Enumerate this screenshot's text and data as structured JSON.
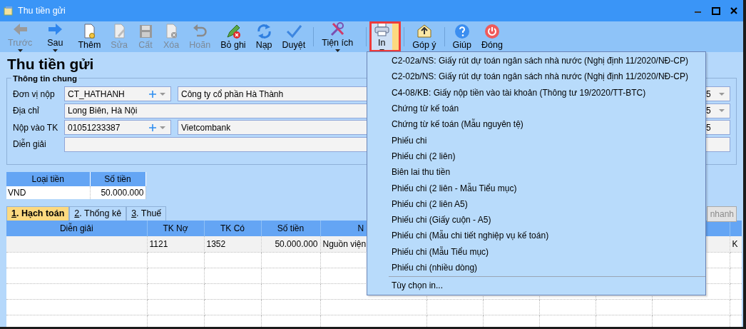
{
  "window": {
    "title": "Thu tiền gửi"
  },
  "toolbar": [
    {
      "label": "Trước",
      "disabled": true,
      "dropdown": true
    },
    {
      "label": "Sau",
      "disabled": false,
      "dropdown": true
    },
    {
      "label": "Thêm",
      "disabled": false
    },
    {
      "label": "Sửa",
      "disabled": true
    },
    {
      "label": "Cất",
      "disabled": true
    },
    {
      "label": "Xóa",
      "disabled": true
    },
    {
      "label": "Hoãn",
      "disabled": true
    },
    {
      "label": "Bỏ ghi",
      "disabled": false
    },
    {
      "label": "Nạp",
      "disabled": false
    },
    {
      "label": "Duyệt",
      "disabled": false
    },
    {
      "label": "Tiện ích",
      "disabled": false,
      "dropdown": true,
      "separator_before": true
    },
    {
      "label": "In",
      "disabled": false,
      "dropdown": true,
      "open": true,
      "separator_before": true
    },
    {
      "label": "Góp ý",
      "disabled": false,
      "separator_before": true
    },
    {
      "label": "Giúp",
      "disabled": false,
      "separator_before": true
    },
    {
      "label": "Đóng",
      "disabled": false
    }
  ],
  "page_title": "Thu tiền gửi",
  "general": {
    "legend": "Thông tin chung",
    "fields": [
      {
        "label": "Đơn vị nộp",
        "kind": "lookup",
        "code": "CT_HATHANH",
        "value": "Công ty cổ phần Hà Thành",
        "side_value": "5",
        "side_dropdown": true
      },
      {
        "label": "Địa chỉ",
        "kind": "text",
        "value": "Long Biên, Hà Nội",
        "side_value": "5",
        "side_dropdown": true
      },
      {
        "label": "Nộp vào TK",
        "kind": "lookup",
        "code": "01051233387",
        "value": "Vietcombank",
        "side_value": "5",
        "side_dropdown": false
      },
      {
        "label": "Diễn giải",
        "kind": "text",
        "side_dropdown": false
      }
    ]
  },
  "currency_table": {
    "columns": [
      "Loại tiền",
      "Số tiền"
    ],
    "rows": [
      [
        "VND",
        "50.000.000"
      ]
    ]
  },
  "tabs": [
    {
      "label": "1. Hạch toán",
      "selected": true
    },
    {
      "label": "2. Thống kê",
      "selected": false
    },
    {
      "label": "3. Thuế",
      "selected": false
    }
  ],
  "quick_button": {
    "label": "nhanh",
    "disabled": true
  },
  "grid": {
    "columns": [
      "Diễn giải",
      "TK Nợ",
      "TK Có",
      "Số tiền",
      "N"
    ],
    "rows": [
      {
        "tk_no": "1121",
        "tk_co": "1352",
        "so_tien": "50.000.000",
        "column_5": "Nguồn viện",
        "column_last": "K"
      }
    ]
  },
  "print_menu": {
    "items": [
      {
        "label": "C2-02a/NS: Giấy rút dự toán ngân sách nhà nước (Nghị định 11/2020/NĐ-CP)"
      },
      {
        "label": "C2-02b/NS: Giấy rút dự toán ngân sách nhà nước (Nghị định 11/2020/NĐ-CP)"
      },
      {
        "label": "C4-08/KB: Giấy nộp tiền vào tài khoản (Thông tư 19/2020/TT-BTC)"
      },
      {
        "label": "Chứng từ kế toán"
      },
      {
        "label": "Chứng từ kế toán (Mẫu nguyên tệ)"
      },
      {
        "label": "Phiếu chi"
      },
      {
        "label": "Phiếu chi (2 liên)"
      },
      {
        "label": "Biên lai thu tiền"
      },
      {
        "label": "Phiếu chi (2 liên - Mẫu Tiểu mục)"
      },
      {
        "label": "Phiếu chi (2 liên A5)"
      },
      {
        "label": "Phiếu chi (Giấy cuộn - A5)"
      },
      {
        "label": "Phiếu chi (Mẫu chi tiết nghiệp vụ kế toán)"
      },
      {
        "label": "Phiếu chi (Mẫu Tiểu mục)"
      },
      {
        "label": "Phiếu chi (nhiều dòng)"
      },
      {
        "label": "Tùy chọn in...",
        "separator_before": true
      }
    ]
  }
}
